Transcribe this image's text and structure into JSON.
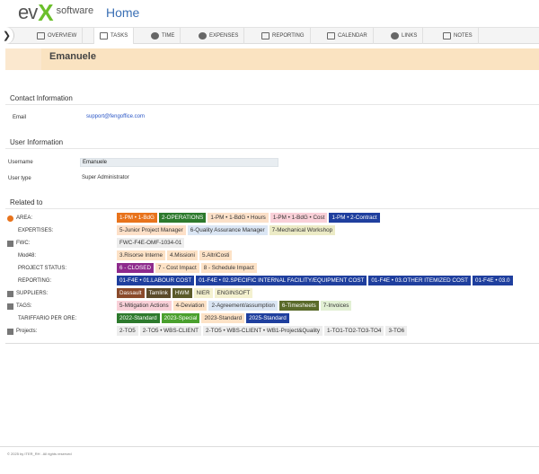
{
  "app": {
    "logo_ev": "ev",
    "logo_x": "X",
    "logo_software": "software",
    "page_title": "Home"
  },
  "tabs": [
    {
      "label": "OVERVIEW",
      "icon": "overview-icon"
    },
    {
      "label": "TASKS",
      "icon": "tasks-icon",
      "active": true
    },
    {
      "label": "TIME",
      "icon": "time-icon"
    },
    {
      "label": "EXPENSES",
      "icon": "expenses-icon"
    },
    {
      "label": "REPORTING",
      "icon": "reporting-icon"
    },
    {
      "label": "CALENDAR",
      "icon": "calendar-icon"
    },
    {
      "label": "LINKS",
      "icon": "links-icon"
    },
    {
      "label": "NOTES",
      "icon": "notes-icon"
    }
  ],
  "header": {
    "name": "Emanuele"
  },
  "contact": {
    "title": "Contact Information",
    "email_label": "Email",
    "email_value": "support@fengoffice.com"
  },
  "user": {
    "title": "User Information",
    "username_label": "Username",
    "username_value": "Emanuele",
    "type_label": "User type",
    "type_value": "Super Administrator"
  },
  "related": {
    "title": "Related to",
    "rows": [
      {
        "label": "AREA:",
        "icon": "area-icon",
        "chips": [
          {
            "text": "1-PM • 1-BdG",
            "bg": "#e8731c",
            "fg": "#ffffff"
          },
          {
            "text": "2-OPERATIONS",
            "bg": "#2d7a2d",
            "fg": "#ffffff"
          },
          {
            "text": "1-PM • 1-BdG • Hours",
            "bg": "#fbe0c8",
            "fg": "#333333"
          },
          {
            "text": "1-PM • 1-BdG • Cost",
            "bg": "#f9d0d8",
            "fg": "#333333"
          },
          {
            "text": "1-PM • 2-Contract",
            "bg": "#1f3f9e",
            "fg": "#ffffff"
          }
        ]
      },
      {
        "label": "EXPERTISES:",
        "icon": "",
        "chips": [
          {
            "text": "5-Junior Project Manager",
            "bg": "#fde0c8",
            "fg": "#333333"
          },
          {
            "text": "6-Quality Assurance Manager",
            "bg": "#dbe6f4",
            "fg": "#333333"
          },
          {
            "text": "7-Mechanical Workshop",
            "bg": "#ecebc6",
            "fg": "#333333"
          }
        ]
      },
      {
        "label": "FWC:",
        "icon": "fwc-icon",
        "chips": [
          {
            "text": "FWC-F4E-OMF-1034-01",
            "bg": "#ededed",
            "fg": "#333333"
          }
        ]
      },
      {
        "label": "Mod48:",
        "icon": "",
        "chips": [
          {
            "text": "3.Risorse Interne",
            "bg": "#fde2c6",
            "fg": "#333333"
          },
          {
            "text": "4.Missioni",
            "bg": "#fde2c6",
            "fg": "#333333"
          },
          {
            "text": "5.AltriCosti",
            "bg": "#fde2c6",
            "fg": "#333333"
          }
        ]
      },
      {
        "label": "PROJECT STATUS:",
        "icon": "",
        "chips": [
          {
            "text": "6 - CLOSED",
            "bg": "#8e2a8c",
            "fg": "#ffffff"
          },
          {
            "text": "7 - Cost Impact",
            "bg": "#fde2c6",
            "fg": "#333333"
          },
          {
            "text": "8 - Schedule Impact",
            "bg": "#fde2c6",
            "fg": "#333333"
          }
        ]
      },
      {
        "label": "REPORTING:",
        "icon": "",
        "chips": [
          {
            "text": "01-F4E • 01.LABOUR COST",
            "bg": "#1f3f9e",
            "fg": "#ffffff"
          },
          {
            "text": "01-F4E • 02.SPECIFIC INTERNAL FACILITY/EQUIPMENT COST",
            "bg": "#1f3f9e",
            "fg": "#ffffff"
          },
          {
            "text": "01-F4E • 03.OTHER ITEMIZED COST",
            "bg": "#1f3f9e",
            "fg": "#ffffff"
          },
          {
            "text": "01-F4E • 03.0",
            "bg": "#1f3f9e",
            "fg": "#ffffff"
          }
        ]
      },
      {
        "label": "SUPPLIERS:",
        "icon": "suppliers-icon",
        "chips": [
          {
            "text": "Dassault",
            "bg": "#8a4a2b",
            "fg": "#ffffff"
          },
          {
            "text": "Tamlink",
            "bg": "#5a4a2a",
            "fg": "#ffffff"
          },
          {
            "text": "HWM",
            "bg": "#5a5a2a",
            "fg": "#ffffff"
          },
          {
            "text": "NIER",
            "bg": "#f4f1cf",
            "fg": "#333333"
          },
          {
            "text": "ENGINSOFT",
            "bg": "#f4f1cf",
            "fg": "#333333"
          }
        ]
      },
      {
        "label": "TAGS:",
        "icon": "tag-icon",
        "chips": [
          {
            "text": "5-Mitigation Actions",
            "bg": "#f9d0d8",
            "fg": "#333333"
          },
          {
            "text": "4-Deviation",
            "bg": "#fde2c6",
            "fg": "#333333"
          },
          {
            "text": "2-Agreement/assumption",
            "bg": "#dbe6f4",
            "fg": "#333333"
          },
          {
            "text": "6-Timesheets",
            "bg": "#5a6a2a",
            "fg": "#ffffff"
          },
          {
            "text": "7-Invoices",
            "bg": "#e2f0d4",
            "fg": "#333333"
          }
        ]
      },
      {
        "label": "TARIFFARIO PER ORE:",
        "icon": "",
        "chips": [
          {
            "text": "2022-Standard",
            "bg": "#2d7a2d",
            "fg": "#ffffff"
          },
          {
            "text": "2023-Special",
            "bg": "#4aa02d",
            "fg": "#ffffff"
          },
          {
            "text": "2023-Standard",
            "bg": "#fde2c6",
            "fg": "#333333"
          },
          {
            "text": "2025-Standard",
            "bg": "#1f3f9e",
            "fg": "#ffffff"
          }
        ]
      },
      {
        "label": "Projects:",
        "icon": "projects-icon",
        "chips": [
          {
            "text": "2-TO5",
            "bg": "#ededed",
            "fg": "#333333"
          },
          {
            "text": "2-TO5 • WBS-CLIENT",
            "bg": "#ededed",
            "fg": "#333333"
          },
          {
            "text": "2-TO5 • WBS-CLIENT • WB1-Project&Quality",
            "bg": "#ededed",
            "fg": "#333333"
          },
          {
            "text": "1-TO1-TO2-TO3-TO4",
            "bg": "#ededed",
            "fg": "#333333"
          },
          {
            "text": "3-TO6",
            "bg": "#ededed",
            "fg": "#333333"
          }
        ]
      }
    ]
  },
  "footer": {
    "text": "© 2025 by ITER_RH . All rights reserved"
  }
}
